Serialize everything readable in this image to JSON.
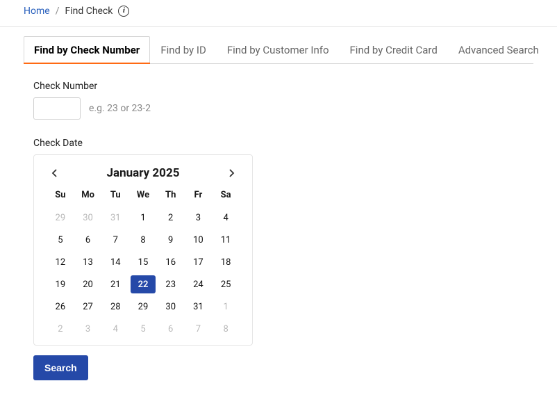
{
  "breadcrumb": {
    "home": "Home",
    "current": "Find Check"
  },
  "tabs": [
    {
      "label": "Find by Check Number",
      "active": true
    },
    {
      "label": "Find by ID",
      "active": false
    },
    {
      "label": "Find by Customer Info",
      "active": false
    },
    {
      "label": "Find by Credit Card",
      "active": false
    },
    {
      "label": "Advanced Search",
      "active": false
    }
  ],
  "form": {
    "check_number_label": "Check Number",
    "check_number_value": "",
    "check_number_hint": "e.g. 23 or 23-2",
    "check_date_label": "Check Date",
    "search_label": "Search"
  },
  "calendar": {
    "title": "January 2025",
    "dow": [
      "Su",
      "Mo",
      "Tu",
      "We",
      "Th",
      "Fr",
      "Sa"
    ],
    "days": [
      {
        "n": "29",
        "out": true
      },
      {
        "n": "30",
        "out": true
      },
      {
        "n": "31",
        "out": true
      },
      {
        "n": "1"
      },
      {
        "n": "2"
      },
      {
        "n": "3"
      },
      {
        "n": "4"
      },
      {
        "n": "5"
      },
      {
        "n": "6"
      },
      {
        "n": "7"
      },
      {
        "n": "8"
      },
      {
        "n": "9"
      },
      {
        "n": "10"
      },
      {
        "n": "11"
      },
      {
        "n": "12"
      },
      {
        "n": "13"
      },
      {
        "n": "14"
      },
      {
        "n": "15"
      },
      {
        "n": "16"
      },
      {
        "n": "17"
      },
      {
        "n": "18"
      },
      {
        "n": "19"
      },
      {
        "n": "20"
      },
      {
        "n": "21"
      },
      {
        "n": "22",
        "sel": true
      },
      {
        "n": "23"
      },
      {
        "n": "24"
      },
      {
        "n": "25"
      },
      {
        "n": "26"
      },
      {
        "n": "27"
      },
      {
        "n": "28"
      },
      {
        "n": "29"
      },
      {
        "n": "30"
      },
      {
        "n": "31"
      },
      {
        "n": "1",
        "out": true
      },
      {
        "n": "2",
        "out": true
      },
      {
        "n": "3",
        "out": true
      },
      {
        "n": "4",
        "out": true
      },
      {
        "n": "5",
        "out": true
      },
      {
        "n": "6",
        "out": true
      },
      {
        "n": "7",
        "out": true
      },
      {
        "n": "8",
        "out": true
      }
    ]
  }
}
